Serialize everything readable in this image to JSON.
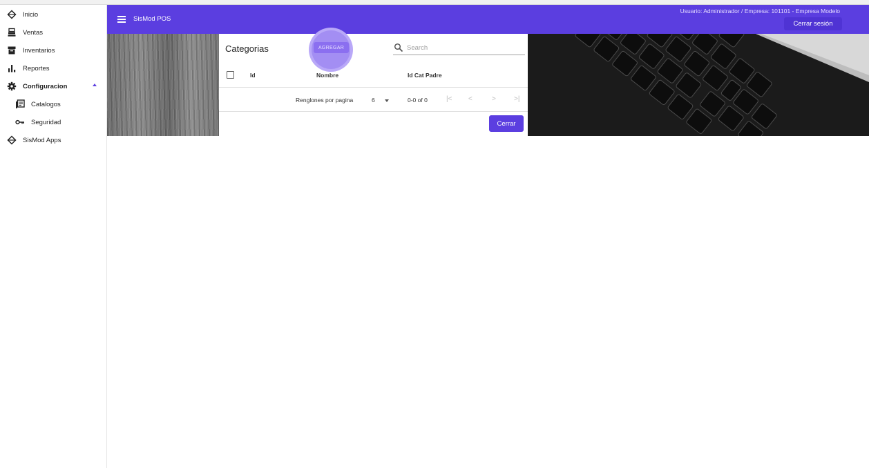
{
  "sidebar": {
    "items": [
      {
        "label": "Inicio",
        "icon": "diamond-outline-icon"
      },
      {
        "label": "Ventas",
        "icon": "cash-register-icon"
      },
      {
        "label": "Inventarios",
        "icon": "archive-box-icon"
      },
      {
        "label": "Reportes",
        "icon": "bar-chart-icon"
      },
      {
        "label": "Configuracion",
        "icon": "gear-icon",
        "expanded": true
      },
      {
        "label": "Catalogos",
        "icon": "list-book-icon"
      },
      {
        "label": "Seguridad",
        "icon": "key-icon"
      },
      {
        "label": "SisMod Apps",
        "icon": "diamond-outline-icon"
      }
    ]
  },
  "appbar": {
    "title": "SisMod POS",
    "user_info": "Usuario: Administrador / Empresa: 101101 - Empresa Modelo",
    "logout_label": "Cerrar sesión"
  },
  "card": {
    "title": "Categorias",
    "add_label": "AGREGAR",
    "search_placeholder": "Search",
    "columns": [
      "Id",
      "Nombre",
      "Id Cat Padre"
    ],
    "rows_per_page_label": "Renglones por pagina",
    "rows_per_page_value": "6",
    "range_text": "0-0 of 0",
    "close_label": "Cerrar"
  },
  "colors": {
    "accent": "#5b3ee0",
    "ripple": "#b9a8f8"
  }
}
